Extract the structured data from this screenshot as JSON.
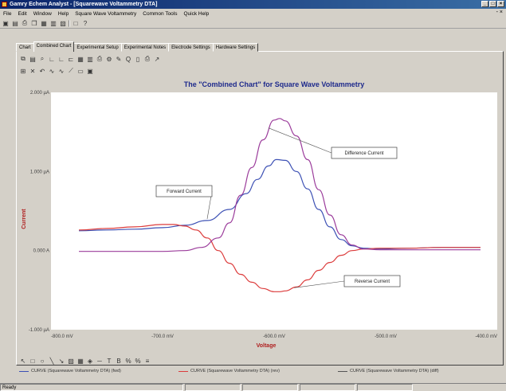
{
  "window": {
    "title": "Gamry Echem Analyst - [Squarewave Voltammetry DTA]"
  },
  "menu": {
    "items": [
      "File",
      "Edit",
      "Window",
      "Help",
      "Square Wave Voltammetry",
      "Common Tools",
      "Quick Help"
    ]
  },
  "tabs": [
    "Chart",
    "Combined Chart",
    "Experimental Setup",
    "Experimental Notes",
    "Electrode Settings",
    "Hardware Settings"
  ],
  "active_tab": "Combined Chart",
  "chart_data": {
    "type": "line",
    "title": "The \"Combined Chart\" for Square Wave Voltammetry",
    "xlabel": "Voltage",
    "ylabel": "Current",
    "xlim": [
      -800,
      -400
    ],
    "ylim": [
      -1.0,
      2.0
    ],
    "x_ticks": [
      "-800.0 mV",
      "-700.0 mV",
      "-600.0 mV",
      "-500.0 mV",
      "-400.0 mV"
    ],
    "y_ticks": [
      "-1.000 µA",
      "0.000 A",
      "1.000 µA",
      "2.000 µA"
    ],
    "series": [
      {
        "name": "CURVE (Squarewave Voltammetry DTA) (fwd)",
        "color": "#3c50b4",
        "x": [
          -775,
          -750,
          -725,
          -700,
          -680,
          -660,
          -640,
          -625,
          -615,
          -605,
          -598,
          -590,
          -580,
          -570,
          -560,
          -550,
          -540,
          -530,
          -520,
          -505,
          -480,
          -450,
          -415
        ],
        "y": [
          0.25,
          0.26,
          0.27,
          0.29,
          0.32,
          0.38,
          0.52,
          0.72,
          0.9,
          1.07,
          1.15,
          1.14,
          1.0,
          0.78,
          0.52,
          0.3,
          0.14,
          0.06,
          0.03,
          0.02,
          0.03,
          0.04,
          0.04
        ]
      },
      {
        "name": "CURVE (Squarewave Voltammetry DTA) (rev)",
        "color": "#dc3c3c",
        "x": [
          -775,
          -750,
          -725,
          -700,
          -690,
          -680,
          -670,
          -660,
          -650,
          -640,
          -630,
          -620,
          -610,
          -600,
          -595,
          -590,
          -580,
          -570,
          -560,
          -550,
          -540,
          -530,
          -520,
          -505,
          -480,
          -450,
          -415
        ],
        "y": [
          0.26,
          0.28,
          0.3,
          0.33,
          0.33,
          0.31,
          0.26,
          0.16,
          0.0,
          -0.16,
          -0.3,
          -0.4,
          -0.48,
          -0.52,
          -0.52,
          -0.51,
          -0.46,
          -0.37,
          -0.25,
          -0.15,
          -0.06,
          0.0,
          0.02,
          0.03,
          0.03,
          0.04,
          0.04
        ]
      },
      {
        "name": "CURVE (Squarewave Voltammetry DTA) (diff)",
        "color": "#9b3c9b",
        "x": [
          -775,
          -750,
          -725,
          -700,
          -680,
          -665,
          -650,
          -640,
          -630,
          -620,
          -610,
          -600,
          -595,
          -590,
          -580,
          -570,
          -560,
          -550,
          -540,
          -530,
          -520,
          -505,
          -480,
          -450,
          -415
        ],
        "y": [
          -0.01,
          -0.01,
          -0.01,
          -0.01,
          0.0,
          0.04,
          0.16,
          0.35,
          0.7,
          1.05,
          1.4,
          1.65,
          1.67,
          1.64,
          1.45,
          1.15,
          0.77,
          0.45,
          0.2,
          0.07,
          0.02,
          0.01,
          0.01,
          0.01,
          0.01
        ]
      }
    ],
    "annotations": [
      {
        "text": "Difference Current"
      },
      {
        "text": "Forward Current"
      },
      {
        "text": "Reverse Current"
      }
    ],
    "grid": false,
    "legend": "bottom"
  },
  "legend": [
    {
      "label": "CURVE (Squarewave Voltammetry DTA) (fwd)",
      "color": "#3c50b4"
    },
    {
      "label": "CURVE (Squarewave Voltammetry DTA) (rev)",
      "color": "#dc3c3c"
    },
    {
      "label": "CURVE (Squarewave Voltammetry DTA) (diff)",
      "color": "#555555"
    }
  ],
  "status": {
    "text": "Ready"
  }
}
